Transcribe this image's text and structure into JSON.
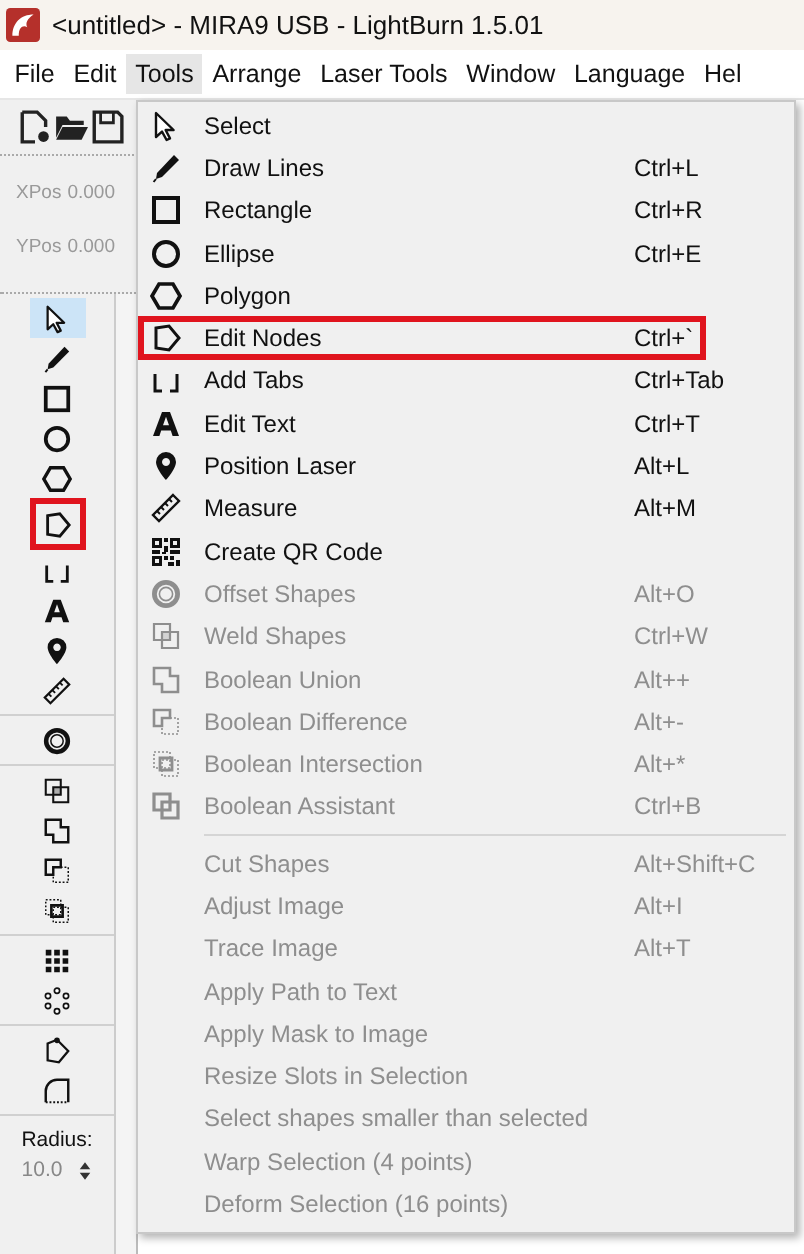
{
  "window": {
    "title": "<untitled> - MIRA9 USB - LightBurn 1.5.01"
  },
  "menu_bar": [
    {
      "label": "File",
      "selected": false
    },
    {
      "label": "Edit",
      "selected": false
    },
    {
      "label": "Tools",
      "selected": true
    },
    {
      "label": "Arrange",
      "selected": false
    },
    {
      "label": "Laser Tools",
      "selected": false
    },
    {
      "label": "Window",
      "selected": false
    },
    {
      "label": "Language",
      "selected": false
    },
    {
      "label": "Hel",
      "selected": false
    }
  ],
  "position": [
    {
      "label": "XPos",
      "value": "0.000"
    },
    {
      "label": "YPos",
      "value": "0.000"
    }
  ],
  "toolbox": {
    "groups": [
      {
        "tools": [
          {
            "selected": true,
            "highlighted": false
          },
          {
            "selected": false,
            "highlighted": false
          },
          {
            "selected": false,
            "highlighted": false
          },
          {
            "selected": false,
            "highlighted": false
          },
          {
            "selected": false,
            "highlighted": false
          },
          {
            "selected": false,
            "highlighted": true
          },
          {
            "selected": false,
            "highlighted": false
          },
          {
            "selected": false,
            "highlighted": false
          },
          {
            "selected": false,
            "highlighted": false
          },
          {
            "selected": false,
            "highlighted": false
          }
        ]
      },
      {
        "tools": [
          {
            "selected": false,
            "highlighted": false
          }
        ]
      },
      {
        "tools": [
          {
            "selected": false,
            "highlighted": false
          },
          {
            "selected": false,
            "highlighted": false
          },
          {
            "selected": false,
            "highlighted": false
          },
          {
            "selected": false,
            "highlighted": false
          }
        ]
      },
      {
        "tools": [
          {
            "selected": false,
            "highlighted": false
          },
          {
            "selected": false,
            "highlighted": false
          }
        ]
      },
      {
        "tools": [
          {
            "selected": false,
            "highlighted": false
          },
          {
            "selected": false,
            "highlighted": false
          }
        ]
      }
    ],
    "radius": {
      "label": "Radius:",
      "value": "10.0"
    }
  },
  "tools_menu": {
    "items": [
      {
        "kind": "item",
        "label": "Select",
        "disabled": false,
        "highlighted": false
      },
      {
        "kind": "item",
        "label": "Draw Lines",
        "shortcut": "Ctrl+L",
        "disabled": false,
        "highlighted": false
      },
      {
        "kind": "item",
        "label": "Rectangle",
        "shortcut": "Ctrl+R",
        "disabled": false,
        "highlighted": false
      },
      {
        "kind": "item",
        "label": "Ellipse",
        "shortcut": "Ctrl+E",
        "disabled": false,
        "highlighted": false
      },
      {
        "kind": "item",
        "label": "Polygon",
        "disabled": false,
        "highlighted": false
      },
      {
        "kind": "item",
        "label": "Edit Nodes",
        "shortcut": "Ctrl+`",
        "disabled": false,
        "highlighted": true
      },
      {
        "kind": "item",
        "label": "Add Tabs",
        "shortcut": "Ctrl+Tab",
        "disabled": false,
        "highlighted": false
      },
      {
        "kind": "item",
        "label": "Edit Text",
        "shortcut": "Ctrl+T",
        "disabled": false,
        "highlighted": false
      },
      {
        "kind": "item",
        "label": "Position Laser",
        "shortcut": "Alt+L",
        "disabled": false,
        "highlighted": false
      },
      {
        "kind": "item",
        "label": "Measure",
        "shortcut": "Alt+M",
        "disabled": false,
        "highlighted": false
      },
      {
        "kind": "item",
        "label": "Create QR Code",
        "disabled": false,
        "highlighted": false
      },
      {
        "kind": "item",
        "label": "Offset Shapes",
        "shortcut": "Alt+O",
        "disabled": true,
        "highlighted": false
      },
      {
        "kind": "item",
        "label": "Weld Shapes",
        "shortcut": "Ctrl+W",
        "disabled": true,
        "highlighted": false
      },
      {
        "kind": "item",
        "label": "Boolean Union",
        "shortcut": "Alt++",
        "disabled": true,
        "highlighted": false
      },
      {
        "kind": "item",
        "label": "Boolean Difference",
        "shortcut": "Alt+-",
        "disabled": true,
        "highlighted": false
      },
      {
        "kind": "item",
        "label": "Boolean Intersection",
        "shortcut": "Alt+*",
        "disabled": true,
        "highlighted": false
      },
      {
        "kind": "item",
        "label": "Boolean Assistant",
        "shortcut": "Ctrl+B",
        "disabled": true,
        "highlighted": false
      },
      {
        "kind": "separator"
      },
      {
        "kind": "item",
        "label": "Cut Shapes",
        "shortcut": "Alt+Shift+C",
        "disabled": true,
        "highlighted": false
      },
      {
        "kind": "item",
        "label": "Adjust Image",
        "shortcut": "Alt+I",
        "disabled": true,
        "highlighted": false
      },
      {
        "kind": "item",
        "label": "Trace Image",
        "shortcut": "Alt+T",
        "disabled": true,
        "highlighted": false
      },
      {
        "kind": "item",
        "label": "Apply Path to Text",
        "disabled": true,
        "highlighted": false
      },
      {
        "kind": "item",
        "label": "Apply Mask to Image",
        "disabled": true,
        "highlighted": false
      },
      {
        "kind": "item",
        "label": "Resize Slots in Selection",
        "disabled": true,
        "highlighted": false
      },
      {
        "kind": "item",
        "label": "Select shapes smaller than selected",
        "disabled": true,
        "highlighted": false
      },
      {
        "kind": "item",
        "label": "Warp Selection (4 points)",
        "disabled": true,
        "highlighted": false
      },
      {
        "kind": "item",
        "label": "Deform Selection (16 points)",
        "disabled": true,
        "highlighted": false
      }
    ]
  }
}
